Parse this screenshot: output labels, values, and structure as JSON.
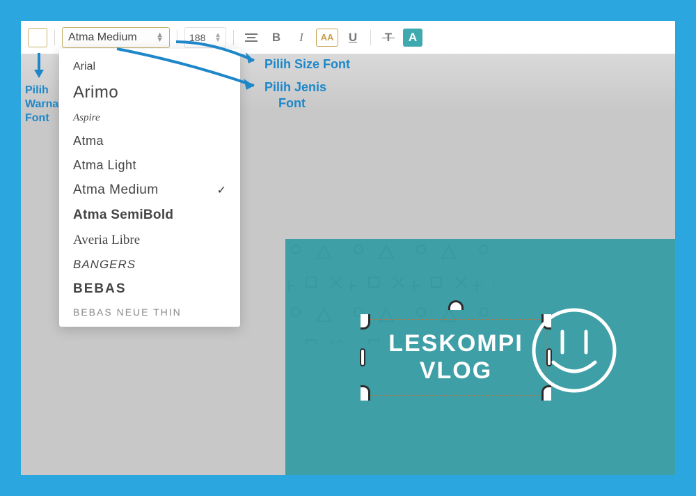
{
  "toolbar": {
    "font_name": "Atma Medium",
    "font_size": "188",
    "bold": "B",
    "italic": "I",
    "uppercase": "AA",
    "underline": "U",
    "strike": "T",
    "highlight": "A"
  },
  "font_dropdown": {
    "items": [
      {
        "label": "Arial",
        "cls": "f-arial"
      },
      {
        "label": "Arimo",
        "cls": "f-arimo"
      },
      {
        "label": "Aspire",
        "cls": "f-aspire"
      },
      {
        "label": "Atma",
        "cls": "f-atma"
      },
      {
        "label": "Atma Light",
        "cls": "f-atmal"
      },
      {
        "label": "Atma Medium",
        "cls": "f-atmam",
        "selected": true
      },
      {
        "label": "Atma SemiBold",
        "cls": "f-atmasb"
      },
      {
        "label": "Averia Libre",
        "cls": "f-averia"
      },
      {
        "label": "Bangers",
        "cls": "f-bangers"
      },
      {
        "label": "Bebas",
        "cls": "f-bebas"
      },
      {
        "label": "Bebas Neue Thin",
        "cls": "f-bebasthin"
      }
    ]
  },
  "annotations": {
    "size": "Pilih Size Font",
    "jenis_line1": "Pilih Jenis",
    "jenis_line2": "Font",
    "warna_line1": "Pilih",
    "warna_line2": "Warna",
    "warna_line3": "Font"
  },
  "design": {
    "text_line1": "LESKOMPI",
    "text_line2": "VLOG"
  }
}
